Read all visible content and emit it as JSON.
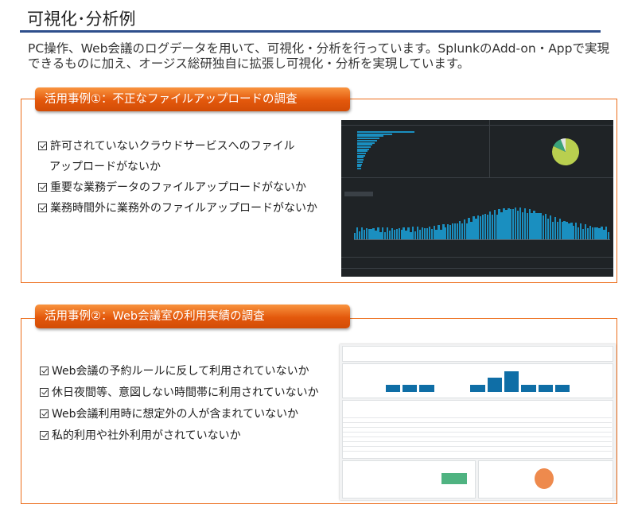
{
  "page": {
    "title": "可視化･分析例",
    "intro": "PC操作、Web会議のログデータを用いて、可視化・分析を行っています。SplunkのAdd-on・Appで実現できるものに加え、オージス総研独自に拡張し可視化・分析を実現しています。"
  },
  "case1": {
    "tab_label": "活用事例①：不正なファイルアップロードの調査",
    "checks": [
      {
        "line1": "許可されていないクラウドサービスへのファイル",
        "line2": "アップロードがないか"
      },
      {
        "line1": "重要な業務データのファイルアップロードがないか"
      },
      {
        "line1": "業務時間外に業務外のファイルアップロードがないか"
      }
    ]
  },
  "case2": {
    "tab_label": "活用事例②：Web会議室の利用実績の調査",
    "checks": [
      {
        "line1": "Web会議の予約ルールに反して利用されていないか"
      },
      {
        "line1": "休日夜間等、意図しない時間帯に利用されていないか"
      },
      {
        "line1": "Web会議利用時に想定外の人が含まれていないか"
      },
      {
        "line1": "私的利用や社外利用がされていないか"
      }
    ]
  },
  "colors": {
    "accent_orange": "#ec6d1b",
    "title_rule": "#2e4f8c",
    "chart_blue": "#1a8fc0",
    "pie_green": "#b9cf4f",
    "pie_teal": "#3aa37a",
    "light_bar": "#0f6ea6",
    "light_green": "#4fb381",
    "light_orange": "#ee8a4d"
  },
  "dashboard1": {
    "hbars": [
      0.95,
      0.58,
      0.44,
      0.37,
      0.33,
      0.29,
      0.25,
      0.22,
      0.2,
      0.17,
      0.15,
      0.13,
      0.11,
      0.1,
      0.09,
      0.08,
      0.07,
      0.06
    ],
    "pie": [
      0.82,
      0.12,
      0.06
    ]
  },
  "dashboard2": {
    "bars": [
      0,
      0,
      0.35,
      0.35,
      0.35,
      0,
      0,
      0.35,
      0.7,
      1.0,
      0.35,
      0.35,
      0.35,
      0,
      0
    ]
  }
}
